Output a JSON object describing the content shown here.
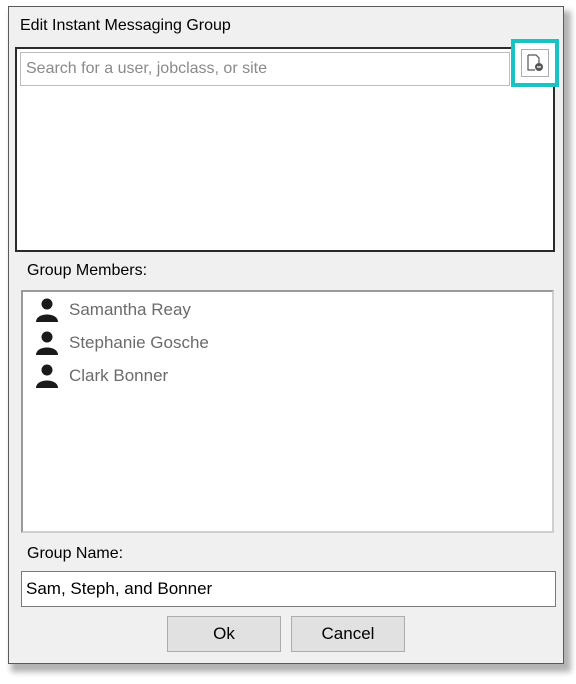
{
  "dialog": {
    "title": "Edit Instant Messaging Group"
  },
  "search": {
    "placeholder": "Search for a user, jobclass, or site",
    "value": "",
    "picker_icon": "file-picker-icon",
    "highlight_color": "#19c2c4"
  },
  "members": {
    "label": "Group Members:",
    "icon": "person-icon",
    "items": [
      {
        "name": "Samantha Reay"
      },
      {
        "name": "Stephanie Gosche"
      },
      {
        "name": "Clark Bonner"
      }
    ]
  },
  "group_name": {
    "label": "Group Name:",
    "value": "Sam, Steph, and Bonner"
  },
  "buttons": {
    "ok_label": "Ok",
    "cancel_label": "Cancel"
  }
}
